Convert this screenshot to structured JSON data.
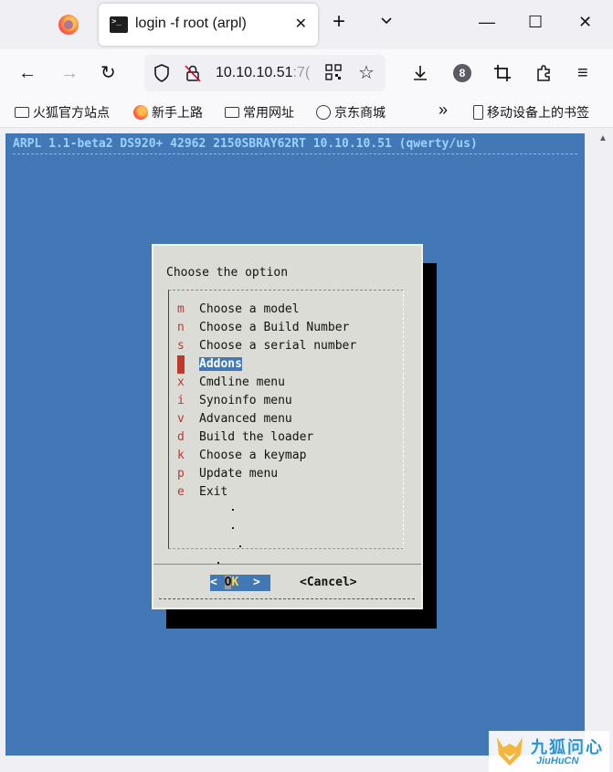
{
  "tab": {
    "title": "login -f root (arpl)",
    "close": "✕"
  },
  "window": {
    "minimize": "—",
    "maximize": "☐",
    "close": "✕"
  },
  "nav": {
    "back": "←",
    "forward": "→",
    "reload": "↻",
    "url_main": "10.10.10.51",
    "url_port": ":7(",
    "star": "☆",
    "extensions_badge": "8",
    "menu": "≡",
    "download": "⤓",
    "crop": "⌗",
    "puzzle": "⧉"
  },
  "bookmarks": {
    "items": [
      {
        "label": "火狐官方站点",
        "icon": "folder-icon"
      },
      {
        "label": "新手上路",
        "icon": "firefox-icon"
      },
      {
        "label": "常用网址",
        "icon": "folder-icon"
      },
      {
        "label": "京东商城",
        "icon": "globe-icon"
      }
    ],
    "overflow": "»",
    "mobile": "移动设备上的书签"
  },
  "terminal": {
    "header": "ARPL 1.1-beta2 DS920+ 42962 2150SBRAY62RT 10.10.10.51 (qwerty/us)",
    "dialog_title": "Choose the option",
    "menu": [
      {
        "key": "m",
        "label": "Choose a model"
      },
      {
        "key": "n",
        "label": "Choose a Build Number"
      },
      {
        "key": "s",
        "label": "Choose a serial number"
      },
      {
        "key": "a",
        "label": "Addons",
        "selected": true
      },
      {
        "key": "x",
        "label": "Cmdline menu"
      },
      {
        "key": "i",
        "label": "Synoinfo menu"
      },
      {
        "key": "v",
        "label": "Advanced menu"
      },
      {
        "key": "d",
        "label": "Build the loader"
      },
      {
        "key": "k",
        "label": "Choose a keymap"
      },
      {
        "key": "p",
        "label": "Update menu"
      },
      {
        "key": "e",
        "label": "Exit"
      }
    ],
    "ok_left": "< ",
    "ok_o": "O",
    "ok_k": "K",
    "ok_right": "  >",
    "cancel": "<Cancel>"
  },
  "watermark": {
    "cn": "九狐问心",
    "en": "JiuHuCN"
  },
  "colors": {
    "terminal_bg": "#4278b5",
    "dialog_bg": "#dcdcd6",
    "hotkey": "#c0392b"
  }
}
